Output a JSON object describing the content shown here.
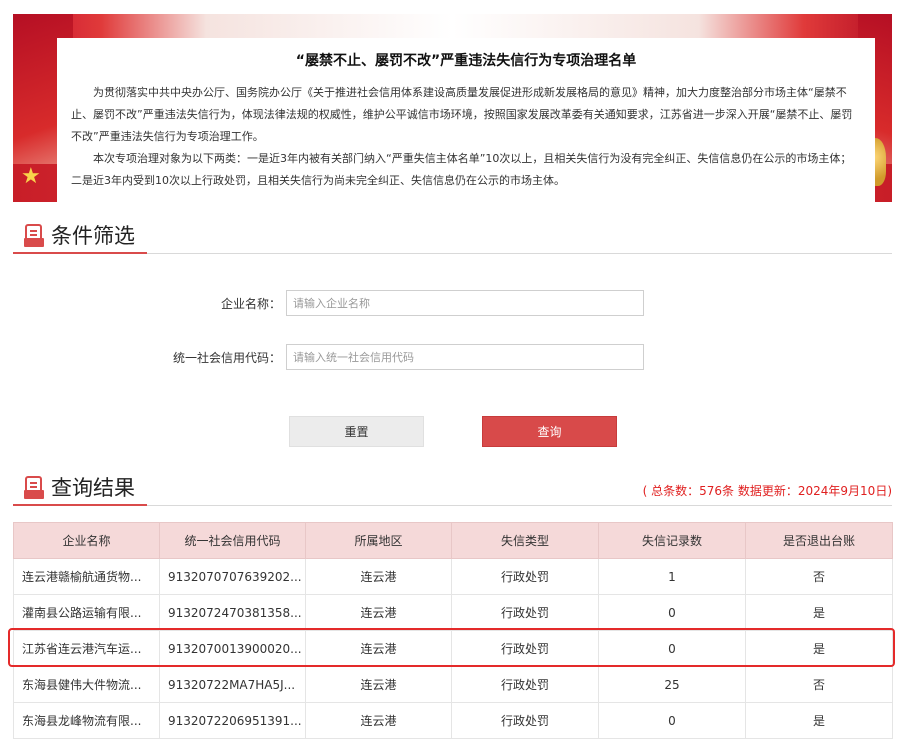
{
  "notice": {
    "title": "“屡禁不止、屡罚不改”严重违法失信行为专项治理名单",
    "paragraph1": "为贯彻落实中共中央办公厅、国务院办公厅《关于推进社会信用体系建设高质量发展促进形成新发展格局的意见》精神，加大力度整治部分市场主体“屡禁不止、屡罚不改”严重违法失信行为，体现法律法规的权威性，维护公平诚信市场环境，按照国家发展改革委有关通知要求，江苏省进一步深入开展“屡禁不止、屡罚不改”严重违法失信行为专项治理工作。",
    "paragraph2": "本次专项治理对象为以下两类：一是近3年内被有关部门纳入“严重失信主体名单”10次以上，且相关失信行为没有完全纠正、失信信息仍在公示的市场主体；二是近3年内受到10次以上行政处罚，且相关失信行为尚未完全纠正、失信信息仍在公示的市场主体。"
  },
  "filter": {
    "section_title": "条件筛选",
    "company_label": "企业名称：",
    "company_placeholder": "请输入企业名称",
    "company_value": "",
    "code_label": "统一社会信用代码：",
    "code_placeholder": "请输入统一社会信用代码",
    "code_value": "",
    "reset_label": "重置",
    "query_label": "查询"
  },
  "results": {
    "section_title": "查询结果",
    "summary": "( 总条数：576条 数据更新：2024年9月10日)",
    "columns": [
      "企业名称",
      "统一社会信用代码",
      "所属地区",
      "失信类型",
      "失信记录数",
      "是否退出台账"
    ],
    "rows": [
      [
        "连云港赣榆航通货物...",
        "9132070707639202...",
        "连云港",
        "行政处罚",
        "1",
        "否"
      ],
      [
        "灌南县公路运输有限...",
        "9132072470381358...",
        "连云港",
        "行政处罚",
        "0",
        "是"
      ],
      [
        "江苏省连云港汽车运...",
        "9132070013900020...",
        "连云港",
        "行政处罚",
        "0",
        "是"
      ],
      [
        "东海县健伟大件物流...",
        "91320722MA7HA5J...",
        "连云港",
        "行政处罚",
        "25",
        "否"
      ],
      [
        "东海县龙峰物流有限...",
        "9132072206951391...",
        "连云港",
        "行政处罚",
        "0",
        "是"
      ]
    ],
    "highlighted_row": 2
  },
  "colors": {
    "accent_red": "#d84a4a",
    "header_pink": "#f5d9d9",
    "highlight_border": "#e42a2a"
  },
  "icons": {
    "section_icon": "document-list-icon"
  }
}
